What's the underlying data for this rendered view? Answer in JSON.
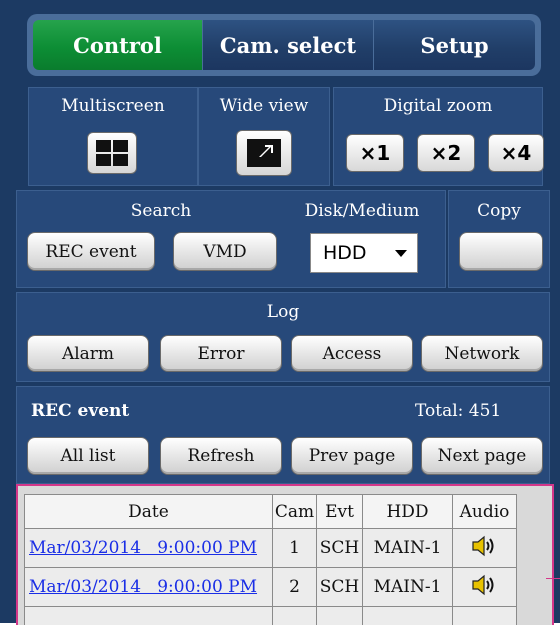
{
  "tabs": [
    {
      "label": "Control",
      "active": true
    },
    {
      "label": "Cam. select",
      "active": false
    },
    {
      "label": "Setup",
      "active": false
    }
  ],
  "multiscreen": {
    "label": "Multiscreen",
    "icon": "quad-screen-icon"
  },
  "wide_view": {
    "label": "Wide view",
    "icon": "expand-arrow-icon"
  },
  "digital_zoom": {
    "label": "Digital zoom",
    "buttons": [
      "×1",
      "×2",
      "×4"
    ]
  },
  "search": {
    "label": "Search",
    "rec_event_button": "REC event",
    "vmd_button": "VMD"
  },
  "disk_medium": {
    "label": "Disk/Medium",
    "selected": "HDD"
  },
  "copy": {
    "label": "Copy",
    "button": ""
  },
  "log": {
    "label": "Log",
    "buttons": [
      "Alarm",
      "Error",
      "Access",
      "Network"
    ]
  },
  "rec_event": {
    "title": "REC event",
    "total": "Total: 451",
    "buttons": [
      "All list",
      "Refresh",
      "Prev page",
      "Next page"
    ]
  },
  "table": {
    "headers": [
      "Date",
      "Cam",
      "Evt",
      "HDD",
      "Audio"
    ],
    "rows": [
      {
        "date": "Mar/03/2014   9:00:00 PM",
        "cam": "1",
        "evt": "SCH",
        "hdd": "MAIN-1",
        "audio_icon": "speaker-icon"
      },
      {
        "date": "Mar/03/2014   9:00:00 PM",
        "cam": "2",
        "evt": "SCH",
        "hdd": "MAIN-1",
        "audio_icon": "speaker-icon"
      }
    ]
  },
  "colors": {
    "panel_bg": "#1c3a63",
    "cell_bg": "#27497a",
    "active_tab": "#0d8e35",
    "highlight_border": "#d4378a"
  }
}
